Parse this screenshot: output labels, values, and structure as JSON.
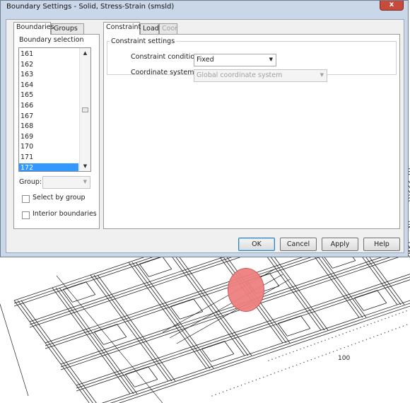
{
  "window": {
    "title": "Boundary Settings - Solid, Stress-Strain (smsld)",
    "close_glyph": "x"
  },
  "left_tabs": [
    {
      "label": "Boundaries",
      "active": true
    },
    {
      "label": "Groups",
      "active": false
    }
  ],
  "boundary_selection": {
    "label": "Boundary selection",
    "items": [
      "161",
      "162",
      "163",
      "164",
      "165",
      "166",
      "167",
      "168",
      "169",
      "170",
      "171",
      "172"
    ],
    "selected": "172"
  },
  "group": {
    "label": "Group:",
    "value": ""
  },
  "checkboxes": {
    "select_by_group": {
      "label": "Select by group",
      "checked": false
    },
    "interior_boundaries": {
      "label": "Interior boundaries",
      "checked": false
    }
  },
  "right_tabs": [
    {
      "label": "Constraint",
      "active": true,
      "enabled": true
    },
    {
      "label": "Load",
      "active": false,
      "enabled": true
    },
    {
      "label": "Coor",
      "active": false,
      "enabled": false
    }
  ],
  "constraint_settings": {
    "legend": "Constraint settings",
    "condition_label": "Constraint condition:",
    "condition_value": "Fixed",
    "coord_label": "Coordinate system:",
    "coord_value": "Global coordinate system"
  },
  "buttons": {
    "ok": "OK",
    "cancel": "Cancel",
    "apply": "Apply",
    "help": "Help"
  },
  "canvas": {
    "dimension_label": "100"
  },
  "colors": {
    "title_bar": "#c9d7e8",
    "close_button": "#c74b3a",
    "selection": "#3399ff",
    "touch_marker": "#ee8080"
  }
}
